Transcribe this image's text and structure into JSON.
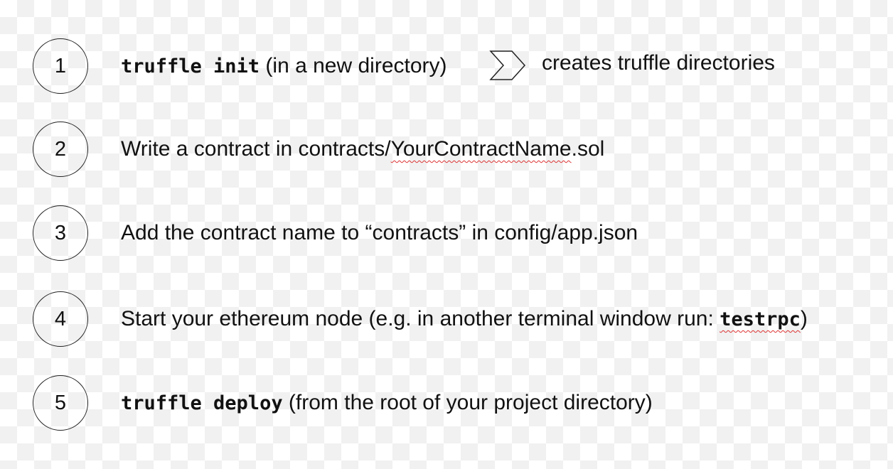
{
  "steps": [
    {
      "number": "1",
      "command": "truffle init",
      "text": " (in a new directory)",
      "arrow_icon": "chevron-right-icon",
      "result": "creates truffle directories"
    },
    {
      "number": "2",
      "text_before": "Write a contract in contracts/",
      "underlined": "YourContractName",
      "text_after": ".sol"
    },
    {
      "number": "3",
      "text": "Add the contract name to “contracts” in config/app.json"
    },
    {
      "number": "4",
      "text_before": "Start your ethereum node (e.g. in another terminal window run: ",
      "command": "testrpc",
      "text_after": ")"
    },
    {
      "number": "5",
      "command": "truffle deploy",
      "text": " (from the root of your project directory)"
    }
  ]
}
